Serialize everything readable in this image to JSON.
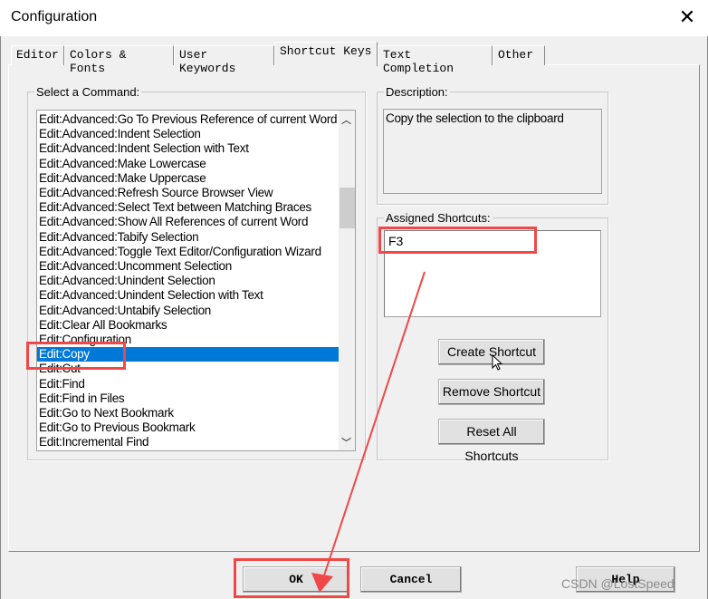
{
  "window": {
    "title": "Configuration",
    "close_icon": "close-icon"
  },
  "tabs": [
    "Editor",
    "Colors & Fonts",
    "User Keywords",
    "Shortcut Keys",
    "Text Completion",
    "Other"
  ],
  "active_tab": "Shortcut Keys",
  "commands": {
    "label": "Select a Command:",
    "items": [
      "Edit:Advanced:Go To Previous Reference of current Word",
      "Edit:Advanced:Indent Selection",
      "Edit:Advanced:Indent Selection with Text",
      "Edit:Advanced:Make Lowercase",
      "Edit:Advanced:Make Uppercase",
      "Edit:Advanced:Refresh Source Browser View",
      "Edit:Advanced:Select Text between Matching Braces",
      "Edit:Advanced:Show All References of current Word",
      "Edit:Advanced:Tabify Selection",
      "Edit:Advanced:Toggle Text Editor/Configuration Wizard",
      "Edit:Advanced:Uncomment Selection",
      "Edit:Advanced:Unindent Selection",
      "Edit:Advanced:Unindent Selection with Text",
      "Edit:Advanced:Untabify Selection",
      "Edit:Clear All Bookmarks",
      "Edit:Configuration",
      "Edit:Copy",
      "Edit:Cut",
      "Edit:Find",
      "Edit:Find in Files",
      "Edit:Go to Next Bookmark",
      "Edit:Go to Previous Bookmark",
      "Edit:Incremental Find"
    ],
    "selected": "Edit:Copy"
  },
  "description": {
    "label": "Description:",
    "text": "Copy the selection to the clipboard"
  },
  "shortcuts": {
    "label": "Assigned Shortcuts:",
    "items": [
      "F3"
    ]
  },
  "buttons": {
    "create": "Create Shortcut",
    "remove": "Remove Shortcut",
    "reset": "Reset All Shortcuts",
    "ok": "OK",
    "cancel": "Cancel",
    "help": "Help"
  },
  "watermark": "CSDN @LostSpeed",
  "annotation_color": "#f04848",
  "selection_color": "#0078d7"
}
